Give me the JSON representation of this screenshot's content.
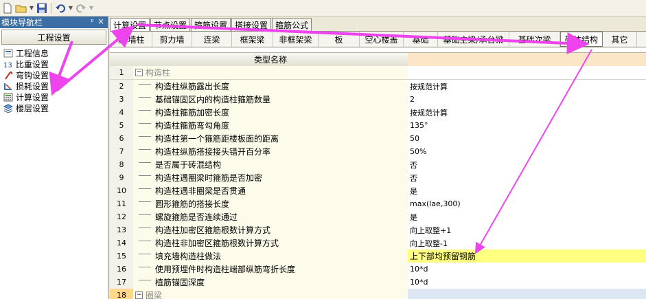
{
  "nav": {
    "title": "模块导航栏",
    "pin": "ᵖ",
    "close": "×",
    "section": "工程设置",
    "items": [
      {
        "label": "工程信息",
        "icon": "info-icon"
      },
      {
        "label": "比重设置",
        "icon": "weight-icon"
      },
      {
        "label": "弯钩设置",
        "icon": "hook-icon"
      },
      {
        "label": "损耗设置",
        "icon": "loss-icon"
      },
      {
        "label": "计算设置",
        "icon": "calculator-icon"
      },
      {
        "label": "楼层设置",
        "icon": "floor-icon"
      }
    ]
  },
  "tabs": [
    "计算设置",
    "节点设置",
    "箍筋设置",
    "搭接设置",
    "箍筋公式"
  ],
  "subtabs": [
    "柱/墙柱",
    "剪力墙",
    "连梁",
    "框架梁",
    "非框架梁",
    "板",
    "空心楼盖",
    "基础",
    "基础主梁/承台梁",
    "基础次梁",
    "砌体结构",
    "其它"
  ],
  "grid": {
    "header": "类型名称",
    "rows": [
      {
        "num": "1",
        "name": "构造柱",
        "value": ""
      },
      {
        "num": "2",
        "name": "构造柱纵筋露出长度",
        "value": "按规范计算"
      },
      {
        "num": "3",
        "name": "基础锚固区内的构造柱箍筋数量",
        "value": "2"
      },
      {
        "num": "4",
        "name": "构造柱箍筋加密长度",
        "value": "按规范计算"
      },
      {
        "num": "5",
        "name": "构造柱箍筋弯勾角度",
        "value": "135°"
      },
      {
        "num": "6",
        "name": "构造柱第一个箍筋距楼板面的距离",
        "value": "50"
      },
      {
        "num": "7",
        "name": "构造柱纵筋搭接接头错开百分率",
        "value": "50%"
      },
      {
        "num": "8",
        "name": "是否属于砖混结构",
        "value": "否"
      },
      {
        "num": "9",
        "name": "构造柱遇圈梁时箍筋是否加密",
        "value": "否"
      },
      {
        "num": "10",
        "name": "构造柱遇非圈梁是否贯通",
        "value": "是"
      },
      {
        "num": "11",
        "name": "圆形箍筋的搭接长度",
        "value": "max(lae,300)"
      },
      {
        "num": "12",
        "name": "螺旋箍筋是否连续通过",
        "value": "是"
      },
      {
        "num": "13",
        "name": "构造柱加密区箍筋根数计算方式",
        "value": "向上取整+1"
      },
      {
        "num": "14",
        "name": "构造柱非加密区箍筋根数计算方式",
        "value": "向上取整-1"
      },
      {
        "num": "15",
        "name": "填充墙构造柱做法",
        "value": "上下部均预留钢筋"
      },
      {
        "num": "16",
        "name": "使用预埋件时构造柱端部纵筋弯折长度",
        "value": "10*d"
      },
      {
        "num": "17",
        "name": "植筋锚固深度",
        "value": "10*d"
      },
      {
        "num": "18",
        "name": "圈梁",
        "value": ""
      }
    ]
  },
  "colors": {
    "annotation_arrow": "#ee44ee",
    "highlight": "#ffff80",
    "header_value_bg": "#fbe7c7"
  }
}
